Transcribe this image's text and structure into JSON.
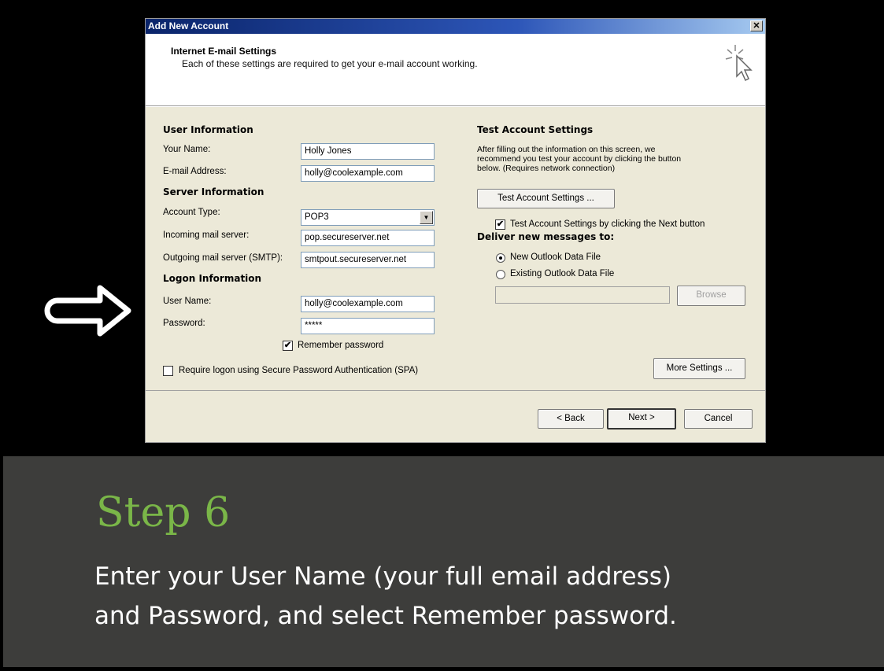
{
  "dialog": {
    "title": "Add New Account",
    "close_label": "✕",
    "header_title": "Internet E-mail Settings",
    "header_subtitle": "Each of these settings are required to get your e-mail account working.",
    "header_icon": "wizard-cursor-icon"
  },
  "user_info": {
    "heading": "User Information",
    "name_label": "Your Name:",
    "name_value": "Holly Jones",
    "email_label": "E-mail Address:",
    "email_value": "holly@coolexample.com"
  },
  "server_info": {
    "heading": "Server Information",
    "account_type_label": "Account Type:",
    "account_type_value": "POP3",
    "incoming_label": "Incoming mail server:",
    "incoming_value": "pop.secureserver.net",
    "outgoing_label": "Outgoing mail server (SMTP):",
    "outgoing_value": "smtpout.secureserver.net"
  },
  "logon_info": {
    "heading": "Logon Information",
    "username_label": "User Name:",
    "username_value": "holly@coolexample.com",
    "password_label": "Password:",
    "password_value": "*****",
    "remember_label": "Remember password",
    "remember_checked": true,
    "spa_label": "Require logon using Secure Password Authentication (SPA)",
    "spa_checked": false
  },
  "test_settings": {
    "heading": "Test Account Settings",
    "description_line1": "After filling out the information on this screen, we",
    "description_line2": "recommend you test your account by clicking the button",
    "description_line3": "below. (Requires network connection)",
    "test_button": "Test Account Settings ...",
    "next_test_label": "Test Account Settings by clicking the Next button",
    "next_test_checked": true
  },
  "deliver": {
    "heading": "Deliver new messages to:",
    "option_new": "New Outlook Data File",
    "option_existing": "Existing Outlook Data File",
    "browse_button": "Browse",
    "selected": "new"
  },
  "buttons": {
    "more_settings": "More Settings ...",
    "back": "< Back",
    "next": "Next >",
    "cancel": "Cancel"
  },
  "caption": {
    "step": "Step 6",
    "line1": "Enter your User Name (your full email address)",
    "line2": "and Password, and select Remember password."
  },
  "colors": {
    "step_green": "#7ab648",
    "caption_bg": "#3d3d3b",
    "titlebar_blue": "#0a246a"
  }
}
